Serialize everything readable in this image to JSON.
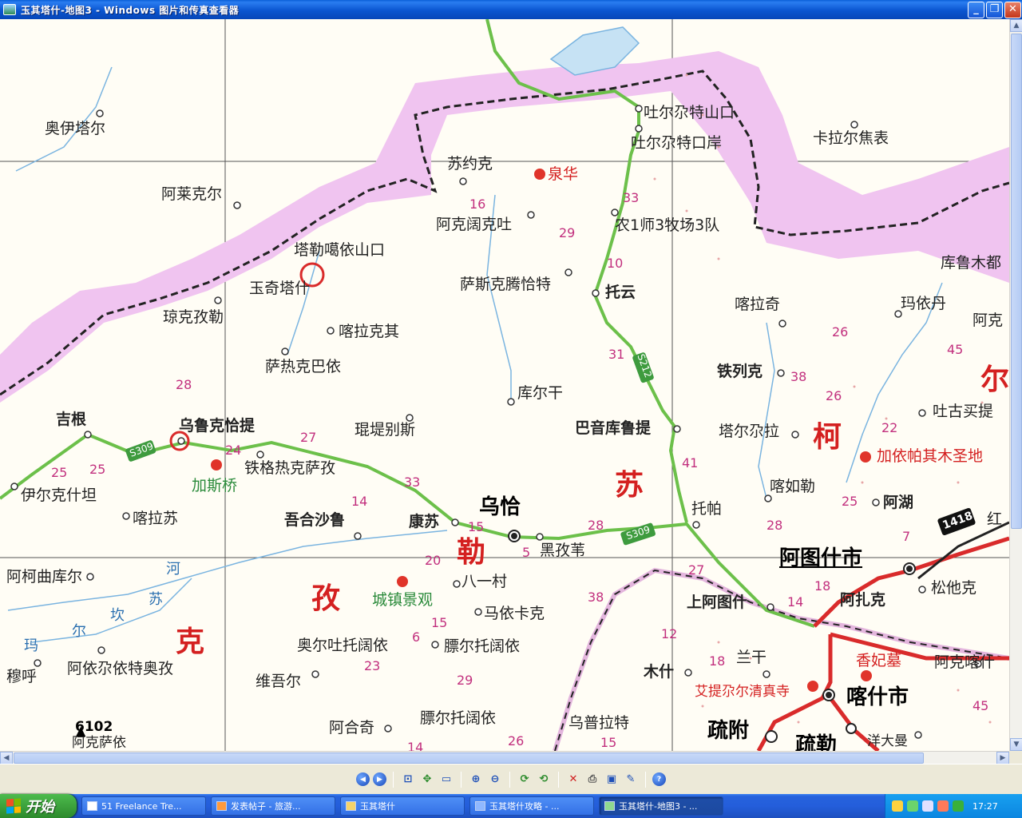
{
  "window": {
    "title": "玉其塔什-地图3 - Windows 图片和传真查看器",
    "buttons": {
      "minimize": "_",
      "maximize": "❐",
      "close": "✕"
    }
  },
  "map": {
    "region_labels": [
      "苏",
      "勒",
      "孜",
      "克",
      "柯",
      "尔"
    ],
    "places": [
      "奥伊塔尔",
      "阿莱克尔",
      "琼克孜勒",
      "玉奇塔什",
      "塔勒噶依山口",
      "喀拉克其",
      "萨热克巴依",
      "吉根",
      "乌鲁克恰提",
      "铁格热克萨孜",
      "加斯桥",
      "伊尔克什坦",
      "喀拉苏",
      "吾合沙鲁",
      "康苏",
      "乌恰",
      "黑孜苇",
      "苏约克",
      "泉华",
      "阿克阔克吐",
      "萨斯克腾恰特",
      "库尔干",
      "琨堤别斯",
      "吐尔尕特山口",
      "吐尔尕特口岸",
      "农1师3牧场3队",
      "托云",
      "巴音库鲁提",
      "托帕",
      "卡拉尔焦表",
      "库鲁木都",
      "喀拉奇",
      "玛依丹",
      "阿克",
      "铁列克",
      "塔尔尕拉",
      "喀如勒",
      "吐古买提",
      "加依帕其木圣地",
      "阿湖",
      "红",
      "阿图什市",
      "松他克",
      "阿扎克",
      "上阿图什",
      "阿柯曲库尔",
      "城镇景观",
      "八一村",
      "马依卡克",
      "奥尔吐托阔依",
      "膘尔托阔依",
      "阿依尕依特奥孜",
      "穆呼",
      "维吾尔",
      "木什",
      "兰干",
      "艾提尕尔清真寺",
      "香妃墓",
      "阿克喀什",
      "喀什市",
      "疏附",
      "疏勒",
      "膘尔托阔依",
      "乌普拉特",
      "阿合奇",
      "阿克萨依",
      "洋大曼"
    ],
    "rivers": [
      "河",
      "苏",
      "坎",
      "尔",
      "玛"
    ],
    "route_numbers": [
      "16",
      "29",
      "33",
      "10",
      "31",
      "41",
      "28",
      "27",
      "33",
      "24",
      "25",
      "25",
      "14",
      "15",
      "20",
      "5",
      "28",
      "6",
      "15",
      "23",
      "29",
      "12",
      "18",
      "14",
      "27",
      "18",
      "38",
      "26",
      "22",
      "25",
      "7",
      "28",
      "45",
      "45",
      "38",
      "26",
      "15",
      "14"
    ],
    "road_shields": [
      "S309",
      "S212",
      "S309",
      "1418"
    ],
    "elevation": "6102",
    "colors": {
      "border_band": "#e6a8e6",
      "road_green": "#6cc04a",
      "road_red": "#d92b2b",
      "river_blue": "#7ab4e0",
      "paper": "#fffdf5",
      "region_red": "#d42020"
    }
  },
  "toolbar": {
    "buttons": [
      {
        "name": "previous-image",
        "glyph": "◀"
      },
      {
        "name": "next-image",
        "glyph": "▶"
      },
      {
        "name": "best-fit",
        "glyph": "⊡"
      },
      {
        "name": "actual-size",
        "glyph": "✥"
      },
      {
        "name": "slideshow",
        "glyph": "▭"
      },
      {
        "name": "zoom-in",
        "glyph": "⊕"
      },
      {
        "name": "zoom-out",
        "glyph": "⊖"
      },
      {
        "name": "rotate-clockwise",
        "glyph": "⟳"
      },
      {
        "name": "rotate-counterclockwise",
        "glyph": "⟲"
      },
      {
        "name": "delete",
        "glyph": "✕"
      },
      {
        "name": "print",
        "glyph": "⎙"
      },
      {
        "name": "save",
        "glyph": "▣"
      },
      {
        "name": "edit",
        "glyph": "✎"
      },
      {
        "name": "help",
        "glyph": "?"
      }
    ]
  },
  "taskbar": {
    "start_label": "开始",
    "tasks": [
      {
        "label": "51 Freelance Tre...",
        "active": false
      },
      {
        "label": "发表帖子 - 旅游...",
        "active": false
      },
      {
        "label": "玉其塔什",
        "active": false
      },
      {
        "label": "玉其塔什攻略 - ...",
        "active": false
      },
      {
        "label": "玉其塔什-地图3 - ...",
        "active": true
      }
    ],
    "clock": "17:27"
  }
}
